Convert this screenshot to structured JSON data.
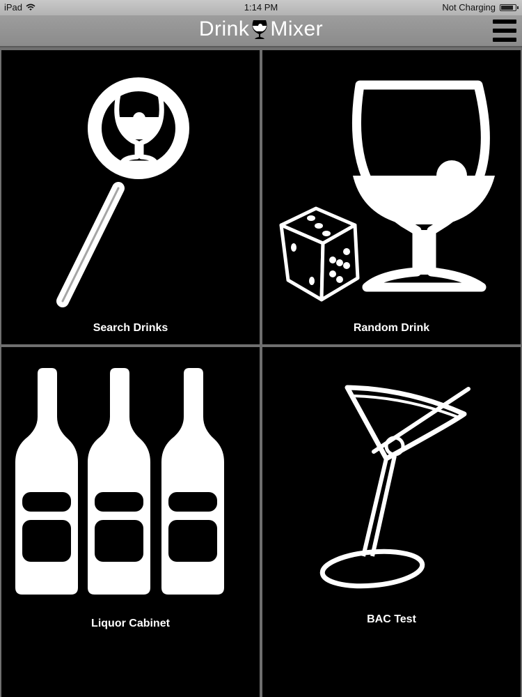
{
  "status_bar": {
    "device": "iPad",
    "time": "1:14 PM",
    "charging": "Not Charging",
    "battery_level": 0.85
  },
  "nav": {
    "title_left": "Drink",
    "title_right": "Mixer",
    "logo_icon": "brandy-glass-icon",
    "menu_icon": "hamburger-menu-icon"
  },
  "tiles": [
    {
      "label": "Search Drinks",
      "icon": "magnifier-glass-icon"
    },
    {
      "label": "Random Drink",
      "icon": "dice-and-glass-icon"
    },
    {
      "label": "Liquor Cabinet",
      "icon": "bottles-icon"
    },
    {
      "label": "BAC Test",
      "icon": "martini-icon"
    }
  ],
  "colors": {
    "tile_bg": "#000000",
    "divider": "#6f6f6f",
    "nav_bg": "#949494",
    "status_bg": "#bfbfbf",
    "icon": "#ffffff"
  }
}
